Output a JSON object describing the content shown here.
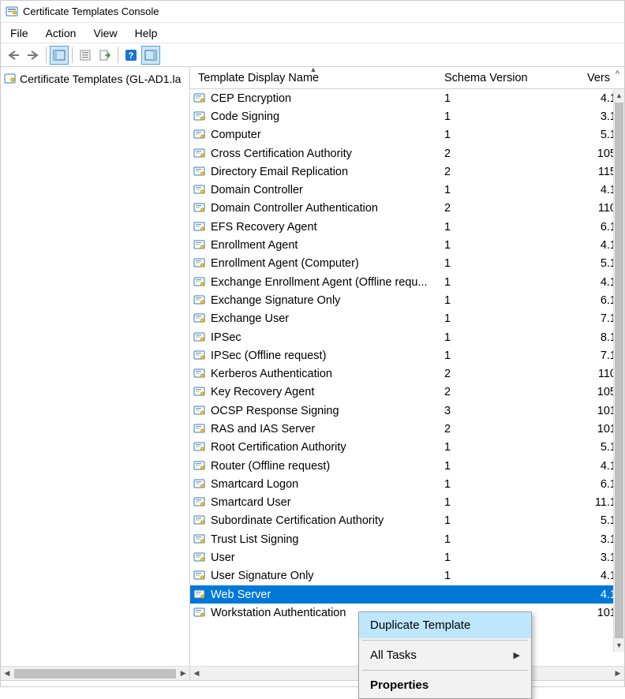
{
  "window": {
    "title": "Certificate Templates Console"
  },
  "menu": {
    "items": [
      "File",
      "Action",
      "View",
      "Help"
    ]
  },
  "tree": {
    "root_label": "Certificate Templates (GL-AD1.la"
  },
  "columns": {
    "name": "Template Display Name",
    "schema": "Schema Version",
    "ver": "Vers"
  },
  "rows": [
    {
      "name": "CEP Encryption",
      "schema": "1",
      "ver": "4.1",
      "selected": false
    },
    {
      "name": "Code Signing",
      "schema": "1",
      "ver": "3.1",
      "selected": false
    },
    {
      "name": "Computer",
      "schema": "1",
      "ver": "5.1",
      "selected": false
    },
    {
      "name": "Cross Certification Authority",
      "schema": "2",
      "ver": "105",
      "selected": false
    },
    {
      "name": "Directory Email Replication",
      "schema": "2",
      "ver": "115",
      "selected": false
    },
    {
      "name": "Domain Controller",
      "schema": "1",
      "ver": "4.1",
      "selected": false
    },
    {
      "name": "Domain Controller Authentication",
      "schema": "2",
      "ver": "110",
      "selected": false
    },
    {
      "name": "EFS Recovery Agent",
      "schema": "1",
      "ver": "6.1",
      "selected": false
    },
    {
      "name": "Enrollment Agent",
      "schema": "1",
      "ver": "4.1",
      "selected": false
    },
    {
      "name": "Enrollment Agent (Computer)",
      "schema": "1",
      "ver": "5.1",
      "selected": false
    },
    {
      "name": "Exchange Enrollment Agent (Offline requ...",
      "schema": "1",
      "ver": "4.1",
      "selected": false
    },
    {
      "name": "Exchange Signature Only",
      "schema": "1",
      "ver": "6.1",
      "selected": false
    },
    {
      "name": "Exchange User",
      "schema": "1",
      "ver": "7.1",
      "selected": false
    },
    {
      "name": "IPSec",
      "schema": "1",
      "ver": "8.1",
      "selected": false
    },
    {
      "name": "IPSec (Offline request)",
      "schema": "1",
      "ver": "7.1",
      "selected": false
    },
    {
      "name": "Kerberos Authentication",
      "schema": "2",
      "ver": "110",
      "selected": false
    },
    {
      "name": "Key Recovery Agent",
      "schema": "2",
      "ver": "105",
      "selected": false
    },
    {
      "name": "OCSP Response Signing",
      "schema": "3",
      "ver": "101",
      "selected": false
    },
    {
      "name": "RAS and IAS Server",
      "schema": "2",
      "ver": "101",
      "selected": false
    },
    {
      "name": "Root Certification Authority",
      "schema": "1",
      "ver": "5.1",
      "selected": false
    },
    {
      "name": "Router (Offline request)",
      "schema": "1",
      "ver": "4.1",
      "selected": false
    },
    {
      "name": "Smartcard Logon",
      "schema": "1",
      "ver": "6.1",
      "selected": false
    },
    {
      "name": "Smartcard User",
      "schema": "1",
      "ver": "11.1",
      "selected": false
    },
    {
      "name": "Subordinate Certification Authority",
      "schema": "1",
      "ver": "5.1",
      "selected": false
    },
    {
      "name": "Trust List Signing",
      "schema": "1",
      "ver": "3.1",
      "selected": false
    },
    {
      "name": "User",
      "schema": "1",
      "ver": "3.1",
      "selected": false
    },
    {
      "name": "User Signature Only",
      "schema": "1",
      "ver": "4.1",
      "selected": false
    },
    {
      "name": "Web Server",
      "schema": "",
      "ver": "4.1",
      "selected": true
    },
    {
      "name": "Workstation Authentication",
      "schema": "",
      "ver": "101",
      "selected": false
    }
  ],
  "context_menu": {
    "duplicate": "Duplicate Template",
    "all_tasks": "All Tasks",
    "properties": "Properties"
  },
  "icons": {
    "app": "cert-app-icon",
    "template": "cert-template-icon"
  }
}
